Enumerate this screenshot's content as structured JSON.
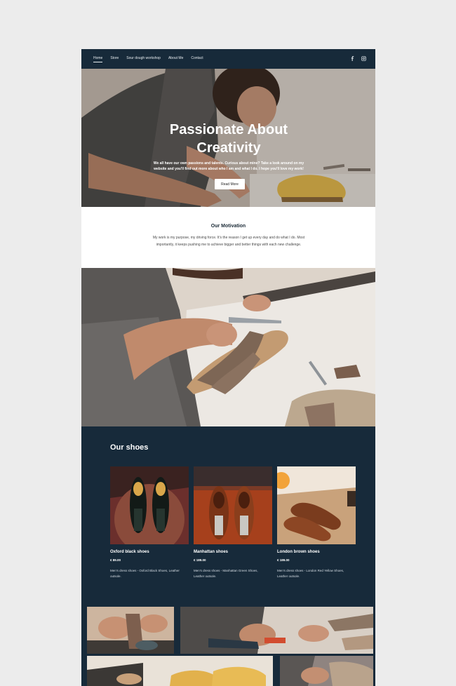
{
  "nav": {
    "links": [
      "Home",
      "Store",
      "Sour dough workshop",
      "About Me",
      "Contact"
    ],
    "active": "Home",
    "social": [
      "facebook-icon",
      "instagram-icon"
    ]
  },
  "hero": {
    "title_line1": "Passionate About",
    "title_line2": "Creativity",
    "subtitle": "We all have our own passions and talents. Curious about mine? Take a look around on my website and you'll find out more about who I am and what I do. I hope you'll love my work!",
    "button": "Read More"
  },
  "motivation": {
    "title": "Our Motivation",
    "text": "My work is my purpose, my driving force. It's the reason I get up every day and do what I do. Most importantly, it keeps pushing me to achieve bigger and better things with each new challenge."
  },
  "shoes": {
    "title": "Our shoes",
    "items": [
      {
        "name": "Oxford black shoes",
        "price": "€ 89.00",
        "desc": "Men's dress shoes - Oxford Black Shoes, Leather outsole."
      },
      {
        "name": "Manhattan shoes",
        "price": "€ 189.00",
        "desc": "Men's dress shoes - Manhattan Green Shoes, Leather outsole."
      },
      {
        "name": "London brown shoes",
        "price": "€ 189.00",
        "desc": "Men's dress shoes - London Red Yellow Shoes, Leather outsole."
      }
    ]
  },
  "colors": {
    "navy": "#172a3a",
    "background": "#ececec",
    "white": "#ffffff"
  }
}
